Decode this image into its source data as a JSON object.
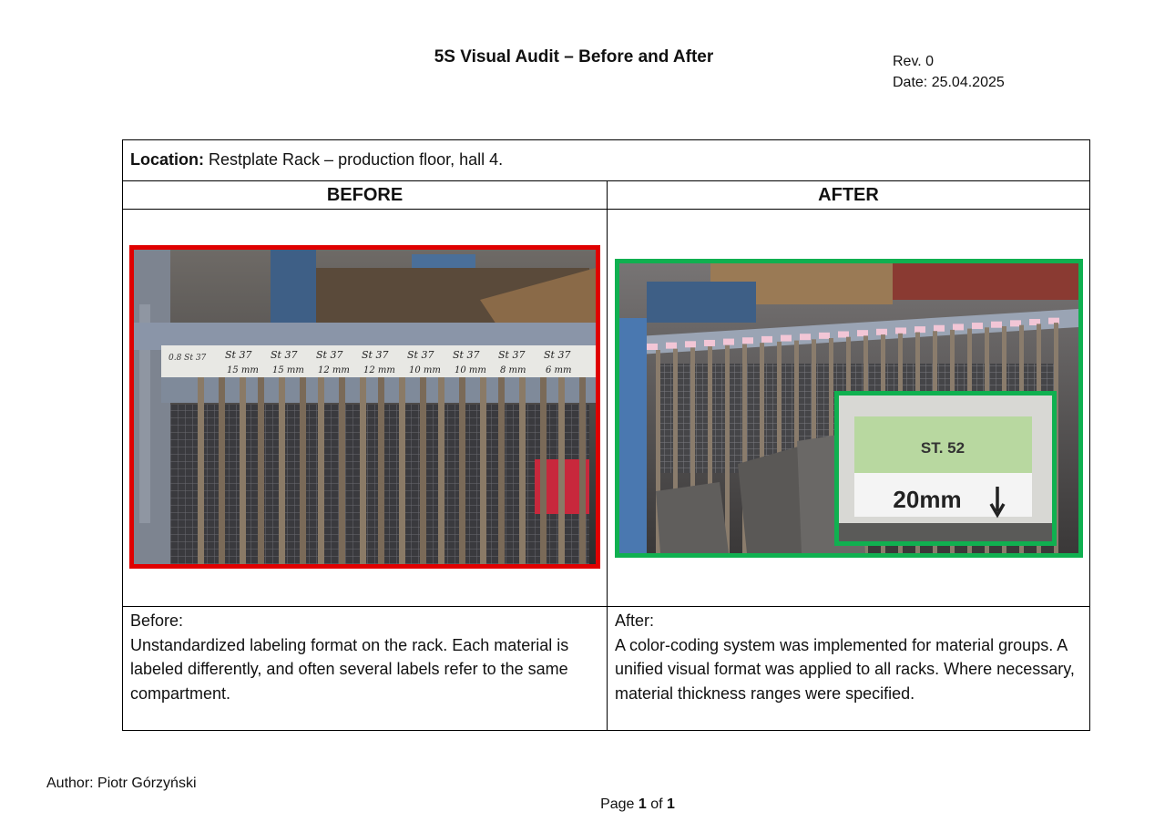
{
  "header": {
    "title": "5S Visual Audit – Before and After",
    "revision": "Rev. 0",
    "date": "Date: 25.04.2025"
  },
  "table": {
    "location_label": "Location:",
    "location_value": " Restplate Rack – production floor, hall 4.",
    "before_header": "BEFORE",
    "after_header": "AFTER",
    "before_title": "Before:",
    "before_text": "Unstandardized labeling format on the rack. Each material is labeled differently, and often several labels refer to the same compartment.",
    "after_title": "After:",
    "after_text": "A color-coding system was implemented for material groups. A unified visual format was applied to all racks. Where necessary, material thickness ranges were specified."
  },
  "images": {
    "before_labels": [
      {
        "top": "St 37",
        "bottom": "15 mm"
      },
      {
        "top": "St 37",
        "bottom": "15 mm"
      },
      {
        "top": "St 37",
        "bottom": "12 mm"
      },
      {
        "top": "St 37",
        "bottom": "12 mm"
      },
      {
        "top": "St 37",
        "bottom": "10 mm"
      },
      {
        "top": "St 37",
        "bottom": "10 mm"
      },
      {
        "top": "St 37",
        "bottom": "8 mm"
      },
      {
        "top": "St 37",
        "bottom": "6 mm"
      }
    ],
    "before_first_label": "0.8 St 37",
    "after_inset_material": "ST. 52",
    "after_inset_thickness": "20mm",
    "before_border_color": "#e00000",
    "after_border_color": "#10b050"
  },
  "footer": {
    "author": "Author: Piotr Górzyński",
    "page_prefix": "Page ",
    "page_current": "1",
    "page_of": " of ",
    "page_total": "1"
  }
}
